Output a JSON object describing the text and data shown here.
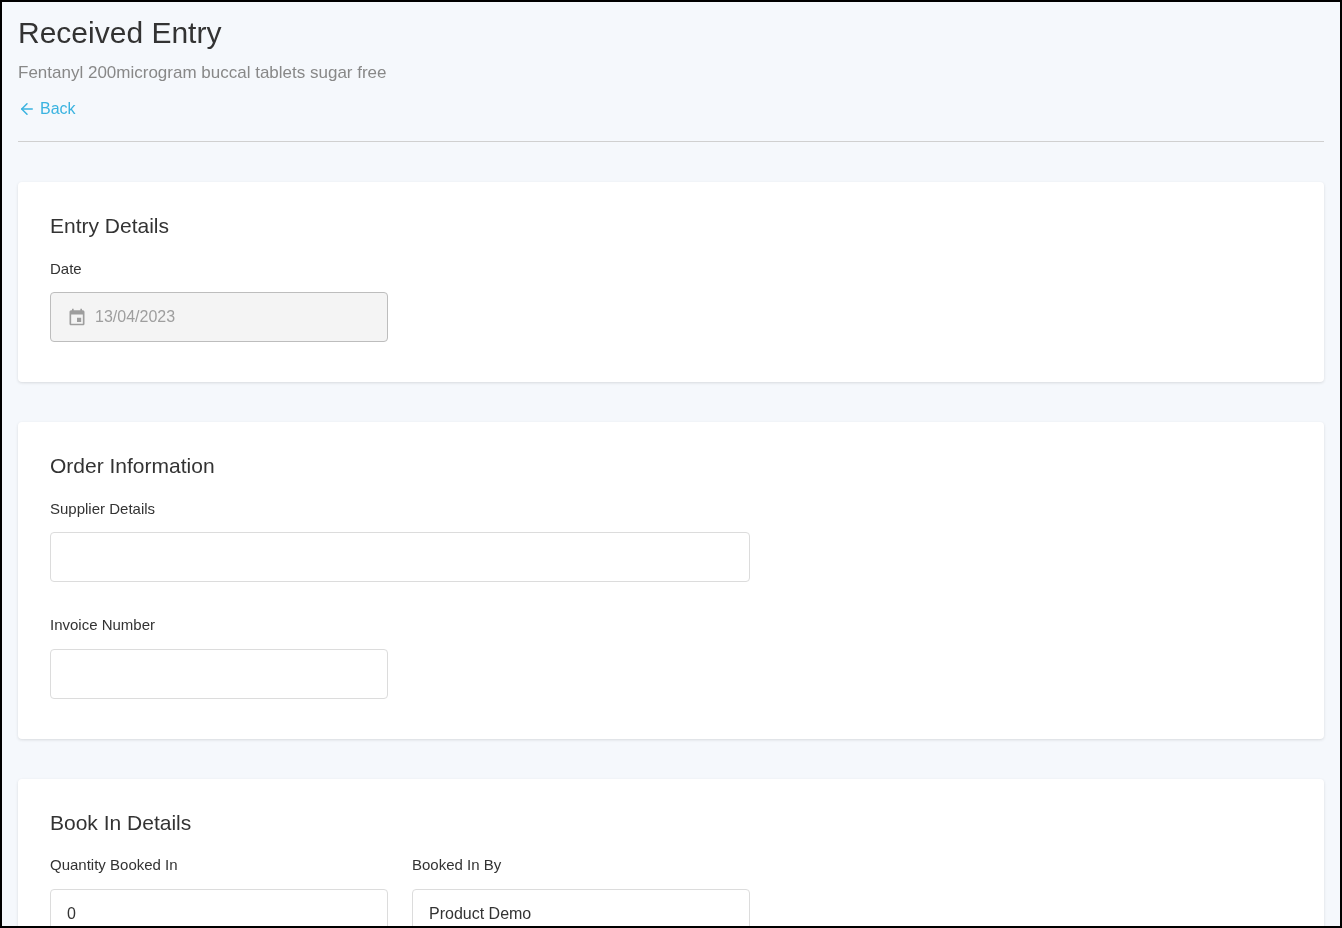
{
  "header": {
    "title": "Received Entry",
    "subtitle": "Fentanyl 200microgram buccal tablets sugar free",
    "back_link": "Back"
  },
  "sections": [
    {
      "title": "Entry Details",
      "rows": [
        [
          {
            "label": "Date",
            "kind": "date",
            "value": "13/04/2023",
            "disabled": true,
            "wide": false
          }
        ]
      ]
    },
    {
      "title": "Order Information",
      "rows": [
        [
          {
            "label": "Supplier Details",
            "kind": "text",
            "disabled": false,
            "wide": true
          }
        ],
        [
          {
            "label": "Invoice Number",
            "kind": "text",
            "disabled": false,
            "wide": false
          }
        ]
      ]
    },
    {
      "title": "Book In Details",
      "rows": [
        [
          {
            "label": "Quantity Booked In",
            "kind": "text",
            "value": "0",
            "disabled": false,
            "wide": false
          },
          {
            "label": "Booked In By",
            "kind": "text",
            "value": "Product Demo",
            "disabled": false,
            "wide": false
          }
        ]
      ]
    }
  ]
}
